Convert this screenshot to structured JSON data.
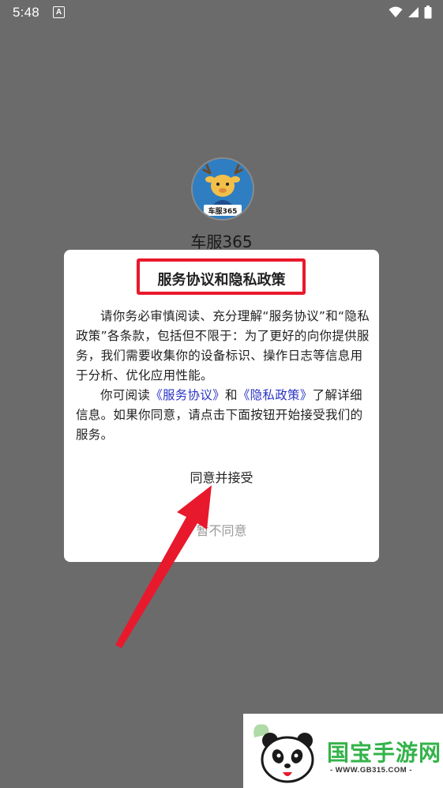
{
  "status_bar": {
    "time": "5:48",
    "notification_icon_letter": "A",
    "icons": [
      "wifi-icon",
      "signal-icon",
      "battery-icon"
    ]
  },
  "app": {
    "name": "车服365",
    "logo_text": "车服365"
  },
  "dialog": {
    "title": "服务协议和隐私政策",
    "paragraph1": "请你务必审慎阅读、充分理解“服务协议”和“隐私政策”各条款，包括但不限于：为了更好的向你提供服务，我们需要收集你的设备标识、操作日志等信息用于分析、优化应用性能。",
    "paragraph2_prefix": "你可阅读",
    "link_service": "《服务协议》",
    "and": "和",
    "link_privacy": "《隐私政策》",
    "paragraph2_suffix": "了解详细信息。如果你同意，请点击下面按钮开始接受我们的服务。",
    "accept_button": "同意并接受",
    "decline_button": "暂不同意"
  },
  "watermark": {
    "brand": "国宝手游网",
    "url": "- WWW.GB315.COM -"
  },
  "colors": {
    "overlay": "#6b6b6b",
    "highlight_red": "#e8192c",
    "link_blue": "#2b34c4",
    "watermark_green": "#34b34a"
  }
}
